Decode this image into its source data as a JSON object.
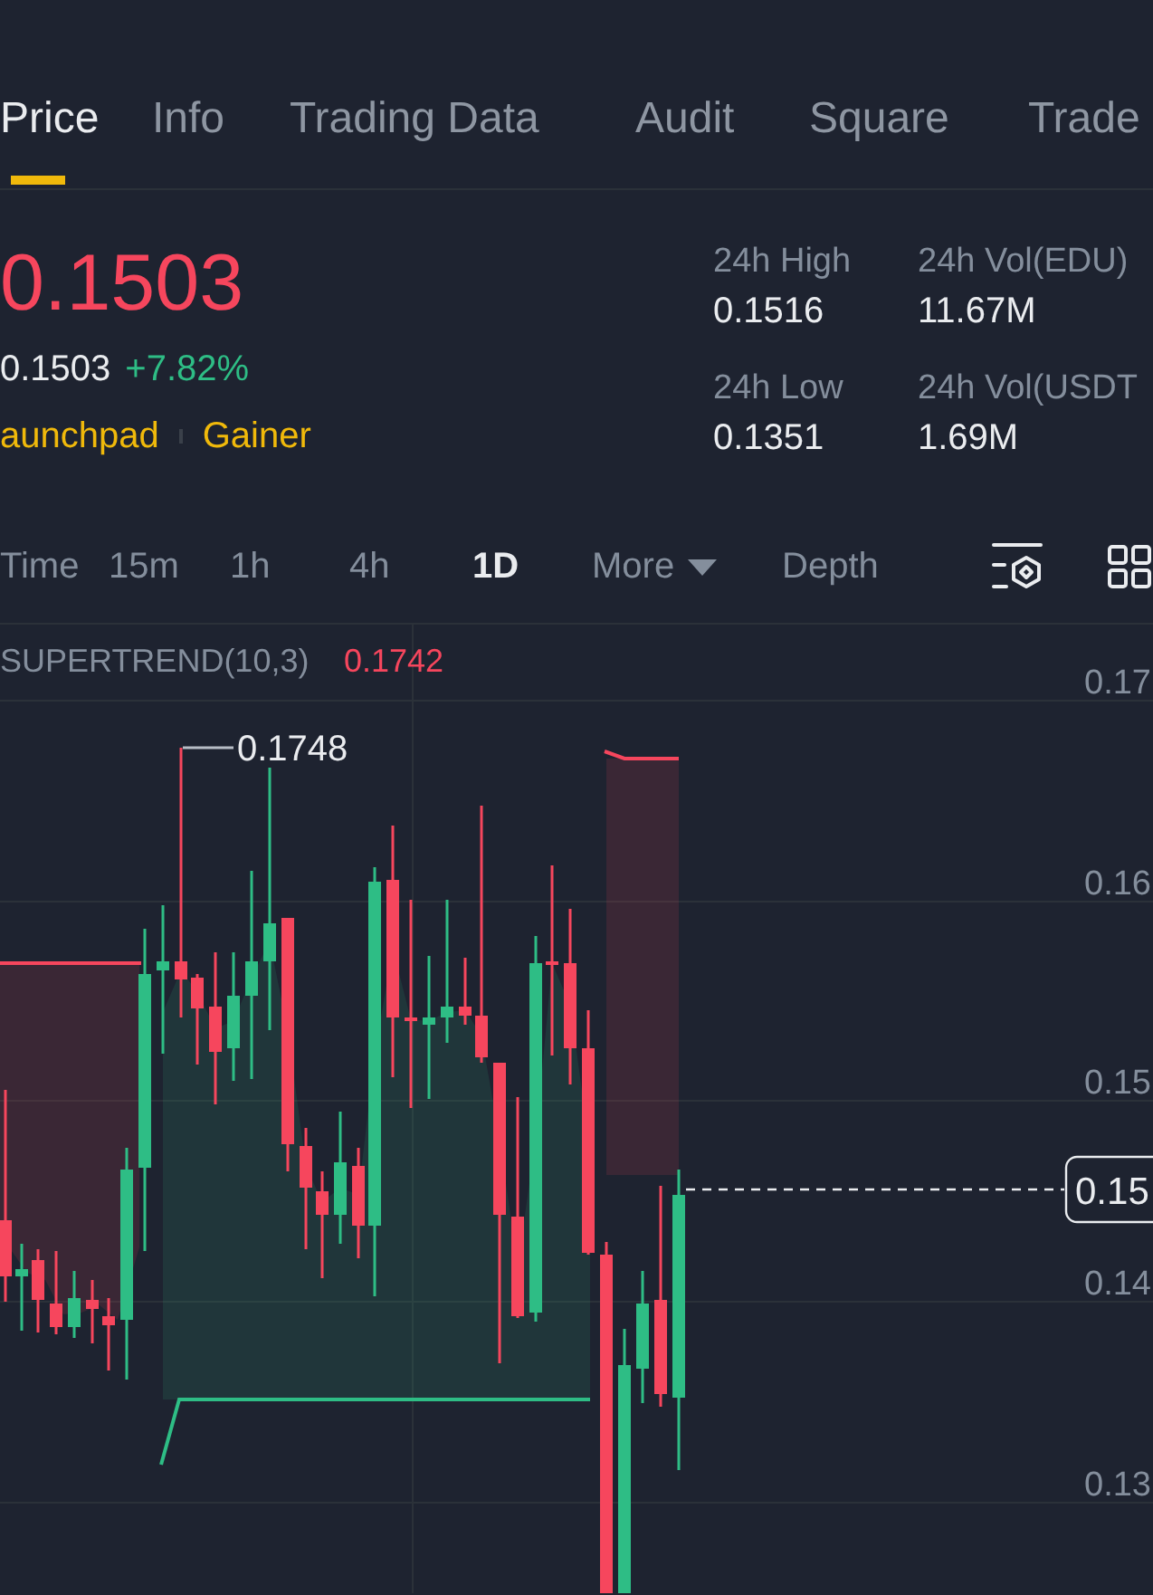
{
  "tabs": [
    {
      "label": "Price",
      "selected": true
    },
    {
      "label": "Info",
      "selected": false
    },
    {
      "label": "Trading Data",
      "selected": false
    },
    {
      "label": "Audit",
      "selected": false
    },
    {
      "label": "Square",
      "selected": false
    },
    {
      "label": "Trade",
      "selected": false
    }
  ],
  "ticker": {
    "last_price": {
      "value": "0.1503",
      "falling": true
    },
    "fiat_price": "0.1503",
    "change": {
      "text": "+7.82%",
      "falling": false
    },
    "tags": [
      "aunchpad",
      "Gainer"
    ]
  },
  "stats": [
    {
      "label": "24h High",
      "value": "0.1516"
    },
    {
      "label": "24h Vol(EDU)",
      "value": "11.67M"
    },
    {
      "label": "24h Low",
      "value": "0.1351"
    },
    {
      "label": "24h Vol(USDT",
      "value": "1.69M"
    }
  ],
  "intervals": [
    {
      "label": "Time",
      "kind": "option",
      "selected": false
    },
    {
      "label": "15m",
      "kind": "option",
      "selected": false
    },
    {
      "label": "1h",
      "kind": "option",
      "selected": false
    },
    {
      "label": "4h",
      "kind": "option",
      "selected": false
    },
    {
      "label": "1D",
      "kind": "option",
      "selected": true
    },
    {
      "label": "More",
      "kind": "dropdown",
      "selected": false
    },
    {
      "label": "Depth",
      "kind": "option",
      "selected": false
    }
  ],
  "chart": {
    "indicator": {
      "name": "SUPERTREND(10,3)",
      "value": "0.1742"
    },
    "high_label": "0.1748",
    "price_tag": "0.15",
    "y_axis_labels": [
      "0.17",
      "0.16",
      "0.15",
      "0.14",
      "0.13"
    ]
  }
}
